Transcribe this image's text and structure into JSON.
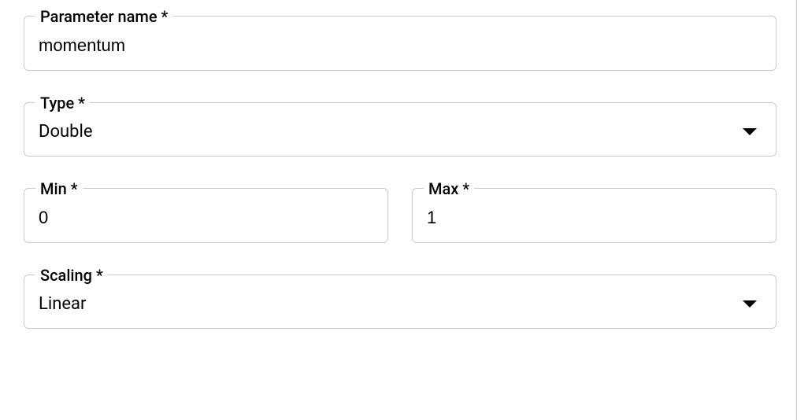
{
  "form": {
    "parameter_name": {
      "label": "Parameter name *",
      "value": "momentum"
    },
    "type": {
      "label": "Type *",
      "value": "Double"
    },
    "min": {
      "label": "Min *",
      "value": "0"
    },
    "max": {
      "label": "Max *",
      "value": "1"
    },
    "scaling": {
      "label": "Scaling *",
      "value": "Linear"
    }
  }
}
